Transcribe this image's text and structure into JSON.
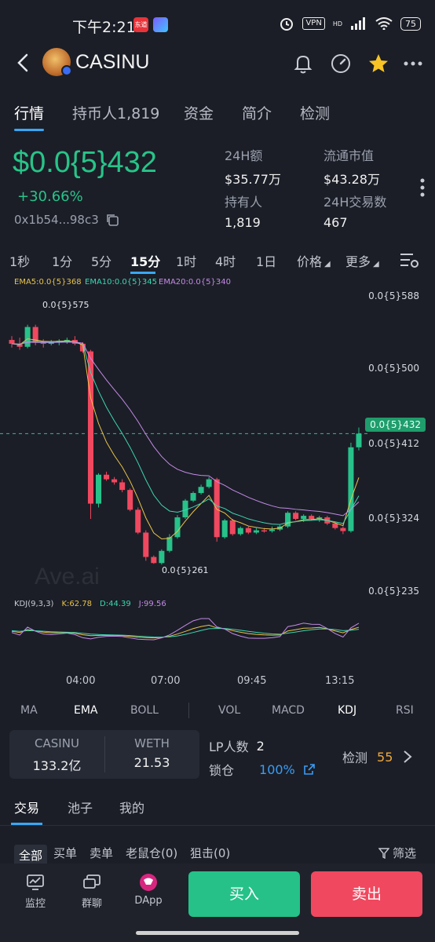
{
  "status_bar": {
    "time": "下午2:21",
    "badge1": "东道",
    "vpn": "VPN",
    "hd": "HD",
    "battery": "75"
  },
  "header": {
    "title": "CASINU"
  },
  "tabs": [
    {
      "label": "行情"
    },
    {
      "label": "持币人1,819"
    },
    {
      "label": "资金"
    },
    {
      "label": "简介"
    },
    {
      "label": "检测"
    }
  ],
  "price": {
    "value": "$0.0{5}432",
    "change": "+30.66%",
    "address": "0x1b54...98c3"
  },
  "stats": {
    "vol_label": "24H额",
    "vol_value": "$35.77万",
    "mcap_label": "流通市值",
    "mcap_value": "$43.28万",
    "holders_label": "持有人",
    "holders_value": "1,819",
    "tx_label": "24H交易数",
    "tx_value": "467"
  },
  "intervals": [
    "1秒",
    "1分",
    "5分",
    "15分",
    "1时",
    "4时",
    "1日"
  ],
  "interval_extra": {
    "price": "价格",
    "more": "更多"
  },
  "chart": {
    "ema5": "EMA5:0.0{5}368",
    "ema10": "EMA10:0.0{5}345",
    "ema20": "EMA20:0.0{5}340",
    "axis": [
      "0.0{5}588",
      "0.0{5}500",
      "0.0{5}412",
      "0.0{5}324",
      "0.0{5}235"
    ],
    "current_tag": "0.0{5}432",
    "high_label": "0.0{5}575",
    "low_label": "0.0{5}261",
    "kdj_label": "KDJ(9,3,3)",
    "kdj_k": "K:62.78",
    "kdj_d": "D:44.39",
    "kdj_j": "J:99.56",
    "times": [
      "04:00",
      "07:00",
      "09:45",
      "13:15"
    ],
    "watermark": "Ave.ai",
    "colors": {
      "up": "#27c28a",
      "down": "#f0485f",
      "ema5": "#e8c34a",
      "ema10": "#3dd6b0",
      "ema20": "#c58ae6"
    }
  },
  "chart_data": {
    "type": "candlestick",
    "interval": "15分",
    "y_axis_ticks": [
      "0.0{5}588",
      "0.0{5}500",
      "0.0{5}412",
      "0.0{5}324",
      "0.0{5}235"
    ],
    "x_axis_ticks": [
      "04:00",
      "07:00",
      "09:45",
      "13:15"
    ],
    "ylim_units_e5": [
      2.2,
      6.2
    ],
    "candles": [
      {
        "o": 5.55,
        "h": 5.6,
        "l": 5.45,
        "c": 5.5
      },
      {
        "o": 5.5,
        "h": 5.58,
        "l": 5.42,
        "c": 5.46
      },
      {
        "o": 5.46,
        "h": 5.75,
        "l": 5.44,
        "c": 5.72
      },
      {
        "o": 5.72,
        "h": 5.75,
        "l": 5.48,
        "c": 5.52
      },
      {
        "o": 5.52,
        "h": 5.56,
        "l": 5.45,
        "c": 5.5
      },
      {
        "o": 5.5,
        "h": 5.55,
        "l": 5.48,
        "c": 5.52
      },
      {
        "o": 5.52,
        "h": 5.56,
        "l": 5.48,
        "c": 5.54
      },
      {
        "o": 5.54,
        "h": 5.58,
        "l": 5.5,
        "c": 5.55
      },
      {
        "o": 5.55,
        "h": 5.6,
        "l": 5.48,
        "c": 5.5
      },
      {
        "o": 5.5,
        "h": 5.52,
        "l": 5.38,
        "c": 5.4
      },
      {
        "o": 5.4,
        "h": 5.42,
        "l": 3.2,
        "c": 3.4
      },
      {
        "o": 3.4,
        "h": 3.8,
        "l": 3.35,
        "c": 3.78
      },
      {
        "o": 3.78,
        "h": 3.82,
        "l": 3.7,
        "c": 3.72
      },
      {
        "o": 3.72,
        "h": 3.75,
        "l": 3.65,
        "c": 3.68
      },
      {
        "o": 3.68,
        "h": 3.72,
        "l": 3.55,
        "c": 3.58
      },
      {
        "o": 3.58,
        "h": 3.6,
        "l": 3.3,
        "c": 3.32
      },
      {
        "o": 3.32,
        "h": 3.35,
        "l": 3.0,
        "c": 3.02
      },
      {
        "o": 3.02,
        "h": 3.05,
        "l": 2.65,
        "c": 2.7
      },
      {
        "o": 2.7,
        "h": 2.72,
        "l": 2.61,
        "c": 2.62
      },
      {
        "o": 2.62,
        "h": 2.8,
        "l": 2.6,
        "c": 2.78
      },
      {
        "o": 2.78,
        "h": 3.0,
        "l": 2.76,
        "c": 2.96
      },
      {
        "o": 2.96,
        "h": 3.25,
        "l": 2.94,
        "c": 3.22
      },
      {
        "o": 3.22,
        "h": 3.46,
        "l": 3.2,
        "c": 3.44
      },
      {
        "o": 3.44,
        "h": 3.56,
        "l": 3.42,
        "c": 3.54
      },
      {
        "o": 3.54,
        "h": 3.65,
        "l": 3.52,
        "c": 3.62
      },
      {
        "o": 3.62,
        "h": 3.75,
        "l": 3.6,
        "c": 3.72
      },
      {
        "o": 3.72,
        "h": 3.74,
        "l": 2.9,
        "c": 2.96
      },
      {
        "o": 2.96,
        "h": 3.2,
        "l": 2.94,
        "c": 3.18
      },
      {
        "o": 3.18,
        "h": 3.2,
        "l": 2.98,
        "c": 3.0
      },
      {
        "o": 3.0,
        "h": 3.1,
        "l": 2.98,
        "c": 3.08
      },
      {
        "o": 3.08,
        "h": 3.1,
        "l": 3.0,
        "c": 3.02
      },
      {
        "o": 3.02,
        "h": 3.08,
        "l": 3.0,
        "c": 3.05
      },
      {
        "o": 3.05,
        "h": 3.08,
        "l": 3.02,
        "c": 3.04
      },
      {
        "o": 3.04,
        "h": 3.1,
        "l": 3.02,
        "c": 3.06
      },
      {
        "o": 3.06,
        "h": 3.12,
        "l": 3.04,
        "c": 3.1
      },
      {
        "o": 3.1,
        "h": 3.3,
        "l": 3.08,
        "c": 3.28
      },
      {
        "o": 3.28,
        "h": 3.3,
        "l": 3.18,
        "c": 3.2
      },
      {
        "o": 3.2,
        "h": 3.26,
        "l": 3.16,
        "c": 3.24
      },
      {
        "o": 3.24,
        "h": 3.26,
        "l": 3.18,
        "c": 3.2
      },
      {
        "o": 3.2,
        "h": 3.24,
        "l": 3.16,
        "c": 3.22
      },
      {
        "o": 3.22,
        "h": 3.24,
        "l": 3.12,
        "c": 3.14
      },
      {
        "o": 3.14,
        "h": 3.16,
        "l": 3.06,
        "c": 3.08
      },
      {
        "o": 3.08,
        "h": 3.1,
        "l": 3.0,
        "c": 3.04
      },
      {
        "o": 3.04,
        "h": 4.2,
        "l": 3.02,
        "c": 4.14
      },
      {
        "o": 4.14,
        "h": 4.4,
        "l": 4.1,
        "c": 4.32
      }
    ],
    "ema5_e5": 3.68,
    "ema10_e5": 3.45,
    "ema20_e5": 3.4,
    "kdj": {
      "k": 62.78,
      "d": 44.39,
      "j": 99.56
    }
  },
  "indicators": [
    "MA",
    "EMA",
    "BOLL",
    "VOL",
    "MACD",
    "KDJ",
    "RSI"
  ],
  "pool": {
    "token_a": "CASINU",
    "token_a_amount": "133.2亿",
    "token_b": "WETH",
    "token_b_amount": "21.53",
    "lp_label": "LP人数",
    "lp_count": "2",
    "lock_label": "锁仓",
    "lock_value": "100%",
    "check_label": "检测",
    "check_score": "55"
  },
  "trade_tabs": [
    "交易",
    "池子",
    "我的"
  ],
  "filters": {
    "all": "全部",
    "buy": "买单",
    "sell": "卖单",
    "rat": "老鼠仓(0)",
    "snipe": "狙击(0)",
    "filter": "筛选"
  },
  "bottom_nav": {
    "monitor": "监控",
    "group": "群聊",
    "dapp": "DApp",
    "buy": "买入",
    "sell": "卖出"
  }
}
